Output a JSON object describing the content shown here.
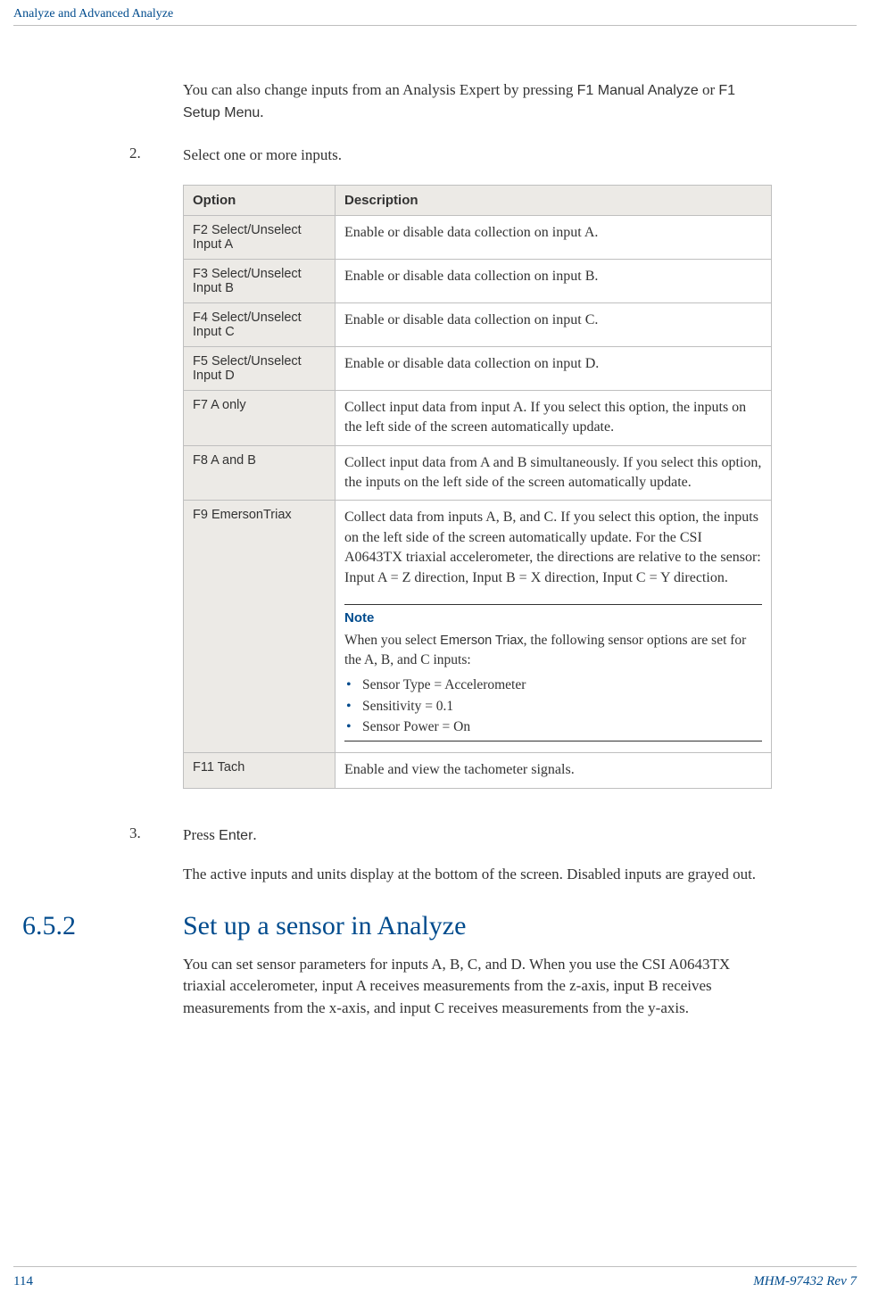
{
  "header": {
    "breadcrumb": "Analyze and Advanced Analyze"
  },
  "intro": {
    "para_prefix": "You can also change inputs from an Analysis Expert by pressing ",
    "code1": "F1 Manual Analyze",
    "middle": " or ",
    "code2": "F1 Setup Menu",
    "suffix": "."
  },
  "steps": {
    "s2": {
      "num": "2.",
      "text": "Select one or more inputs."
    },
    "s3": {
      "num": "3.",
      "prefix": "Press ",
      "code": "Enter",
      "suffix": "."
    }
  },
  "table": {
    "headers": {
      "option": "Option",
      "description": "Description"
    },
    "rows": [
      {
        "option": "F2 Select/Unselect Input A",
        "desc": "Enable or disable data collection on input A."
      },
      {
        "option": "F3 Select/Unselect Input B",
        "desc": "Enable or disable data collection on input B."
      },
      {
        "option": "F4 Select/Unselect Input C",
        "desc": "Enable or disable data collection on input C."
      },
      {
        "option": "F5 Select/Unselect Input D",
        "desc": "Enable or disable data collection on input D."
      },
      {
        "option": "F7 A only",
        "desc": "Collect input data from input A. If you select this option, the inputs on the left side of the screen automatically update."
      },
      {
        "option": "F8 A and B",
        "desc": "Collect input data from A and B simultaneously. If you select this option, the inputs on the left side of the screen automatically update."
      },
      {
        "option": "F9 EmersonTriax",
        "desc": "Collect data from inputs A, B, and C. If you select this option, the inputs on the left side of the screen automatically update. For the CSI A0643TX triaxial accelerometer, the directions are relative to the sensor: Input A = Z direction, Input B = X direction, Input C = Y direction."
      },
      {
        "option": "F11 Tach",
        "desc": "Enable and view the tachometer signals."
      }
    ]
  },
  "note": {
    "label": "Note",
    "intro_prefix": "When you select ",
    "intro_code": "Emerson Triax",
    "intro_suffix": ", the following sensor options are set for the A, B, and C inputs:",
    "bullets": [
      "Sensor Type = Accelerometer",
      "Sensitivity = 0.1",
      "Sensor Power = On"
    ]
  },
  "after_step3_para": "The active inputs and units display at the bottom of the screen. Disabled inputs are grayed out.",
  "section": {
    "number": "6.5.2",
    "title": "Set up a sensor in Analyze",
    "para": "You can set sensor parameters for inputs A, B, C, and D. When you use the CSI A0643TX triaxial accelerometer, input A receives measurements from the z-axis, input B receives measurements from the x-axis, and input C receives measurements from the y-axis."
  },
  "footer": {
    "page": "114",
    "docid": "MHM-97432 Rev 7"
  }
}
